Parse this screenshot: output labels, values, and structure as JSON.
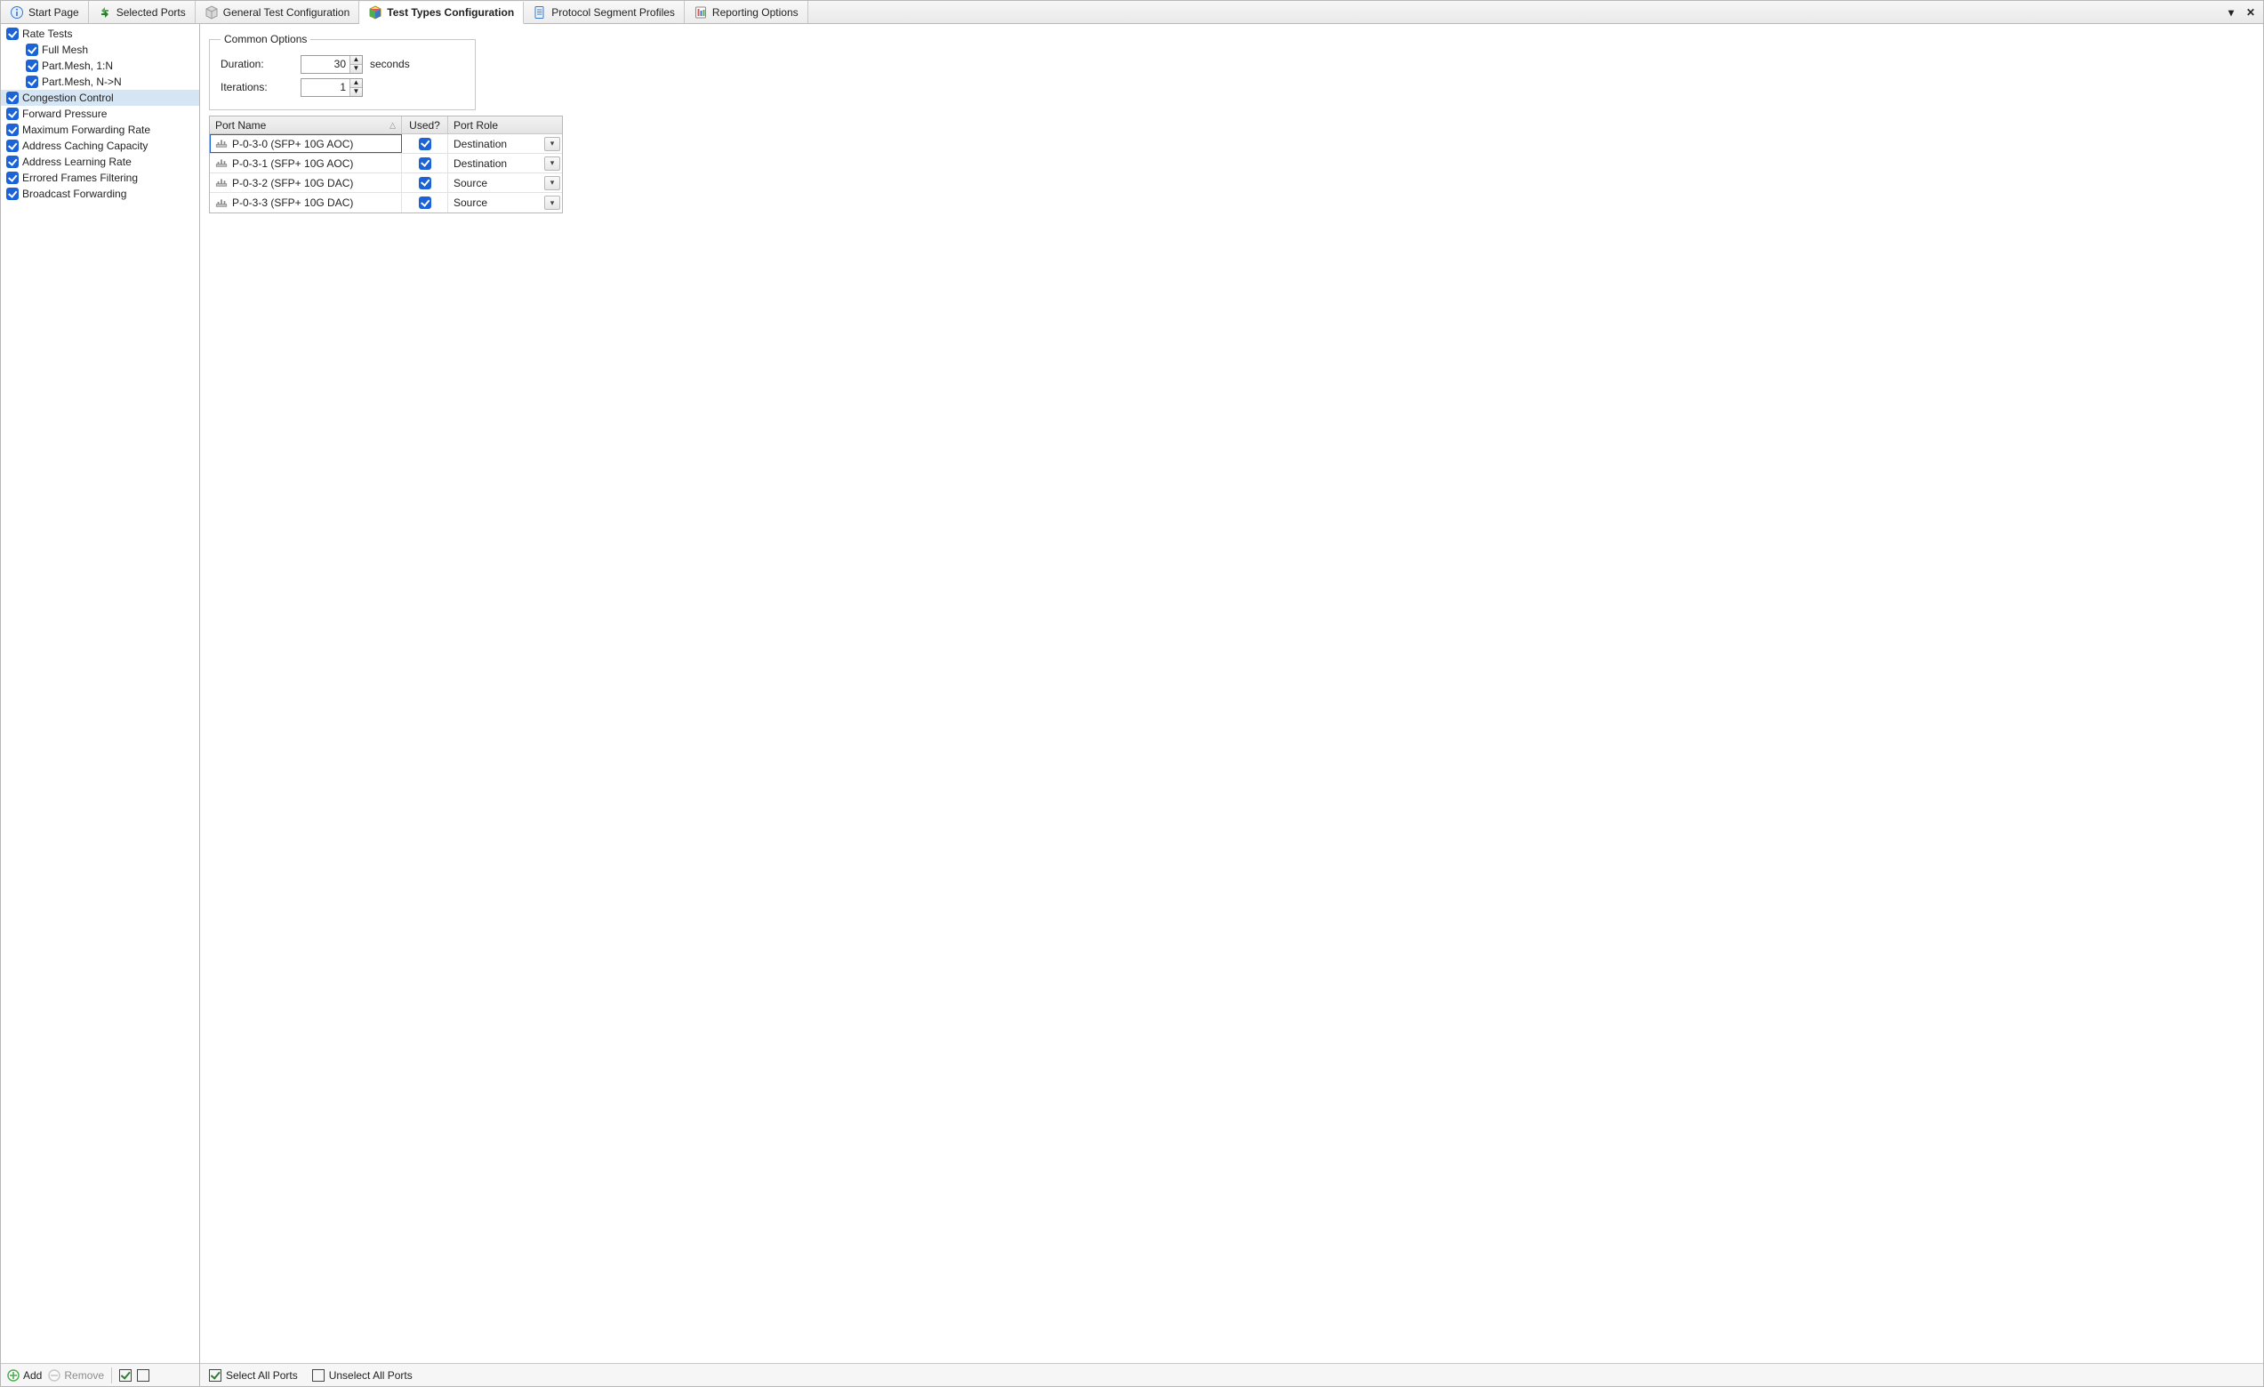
{
  "tabs": [
    {
      "label": "Start Page"
    },
    {
      "label": "Selected Ports"
    },
    {
      "label": "General Test Configuration"
    },
    {
      "label": "Test Types Configuration"
    },
    {
      "label": "Protocol Segment Profiles"
    },
    {
      "label": "Reporting Options"
    }
  ],
  "active_tab_index": 3,
  "tree": [
    {
      "label": "Rate Tests",
      "level": 0,
      "checked": true
    },
    {
      "label": "Full Mesh",
      "level": 1,
      "checked": true
    },
    {
      "label": "Part.Mesh, 1:N",
      "level": 1,
      "checked": true
    },
    {
      "label": "Part.Mesh, N->N",
      "level": 1,
      "checked": true
    },
    {
      "label": "Congestion Control",
      "level": 0,
      "checked": true,
      "selected": true
    },
    {
      "label": "Forward Pressure",
      "level": 0,
      "checked": true
    },
    {
      "label": "Maximum Forwarding Rate",
      "level": 0,
      "checked": true
    },
    {
      "label": "Address Caching Capacity",
      "level": 0,
      "checked": true
    },
    {
      "label": "Address Learning Rate",
      "level": 0,
      "checked": true
    },
    {
      "label": "Errored Frames Filtering",
      "level": 0,
      "checked": true
    },
    {
      "label": "Broadcast Forwarding",
      "level": 0,
      "checked": true
    }
  ],
  "left_toolbar": {
    "add": "Add",
    "remove": "Remove"
  },
  "common_options": {
    "legend": "Common Options",
    "duration_label": "Duration:",
    "duration_value": "30",
    "duration_unit": "seconds",
    "iterations_label": "Iterations:",
    "iterations_value": "1"
  },
  "grid": {
    "headers": {
      "port_name": "Port Name",
      "used": "Used?",
      "port_role": "Port Role"
    },
    "rows": [
      {
        "name": "P-0-3-0 (SFP+ 10G AOC)",
        "used": true,
        "role": "Destination",
        "selected": true
      },
      {
        "name": "P-0-3-1 (SFP+ 10G AOC)",
        "used": true,
        "role": "Destination"
      },
      {
        "name": "P-0-3-2 (SFP+ 10G DAC)",
        "used": true,
        "role": "Source"
      },
      {
        "name": "P-0-3-3 (SFP+ 10G DAC)",
        "used": true,
        "role": "Source"
      }
    ]
  },
  "right_toolbar": {
    "select_all": "Select All Ports",
    "unselect_all": "Unselect All Ports"
  }
}
